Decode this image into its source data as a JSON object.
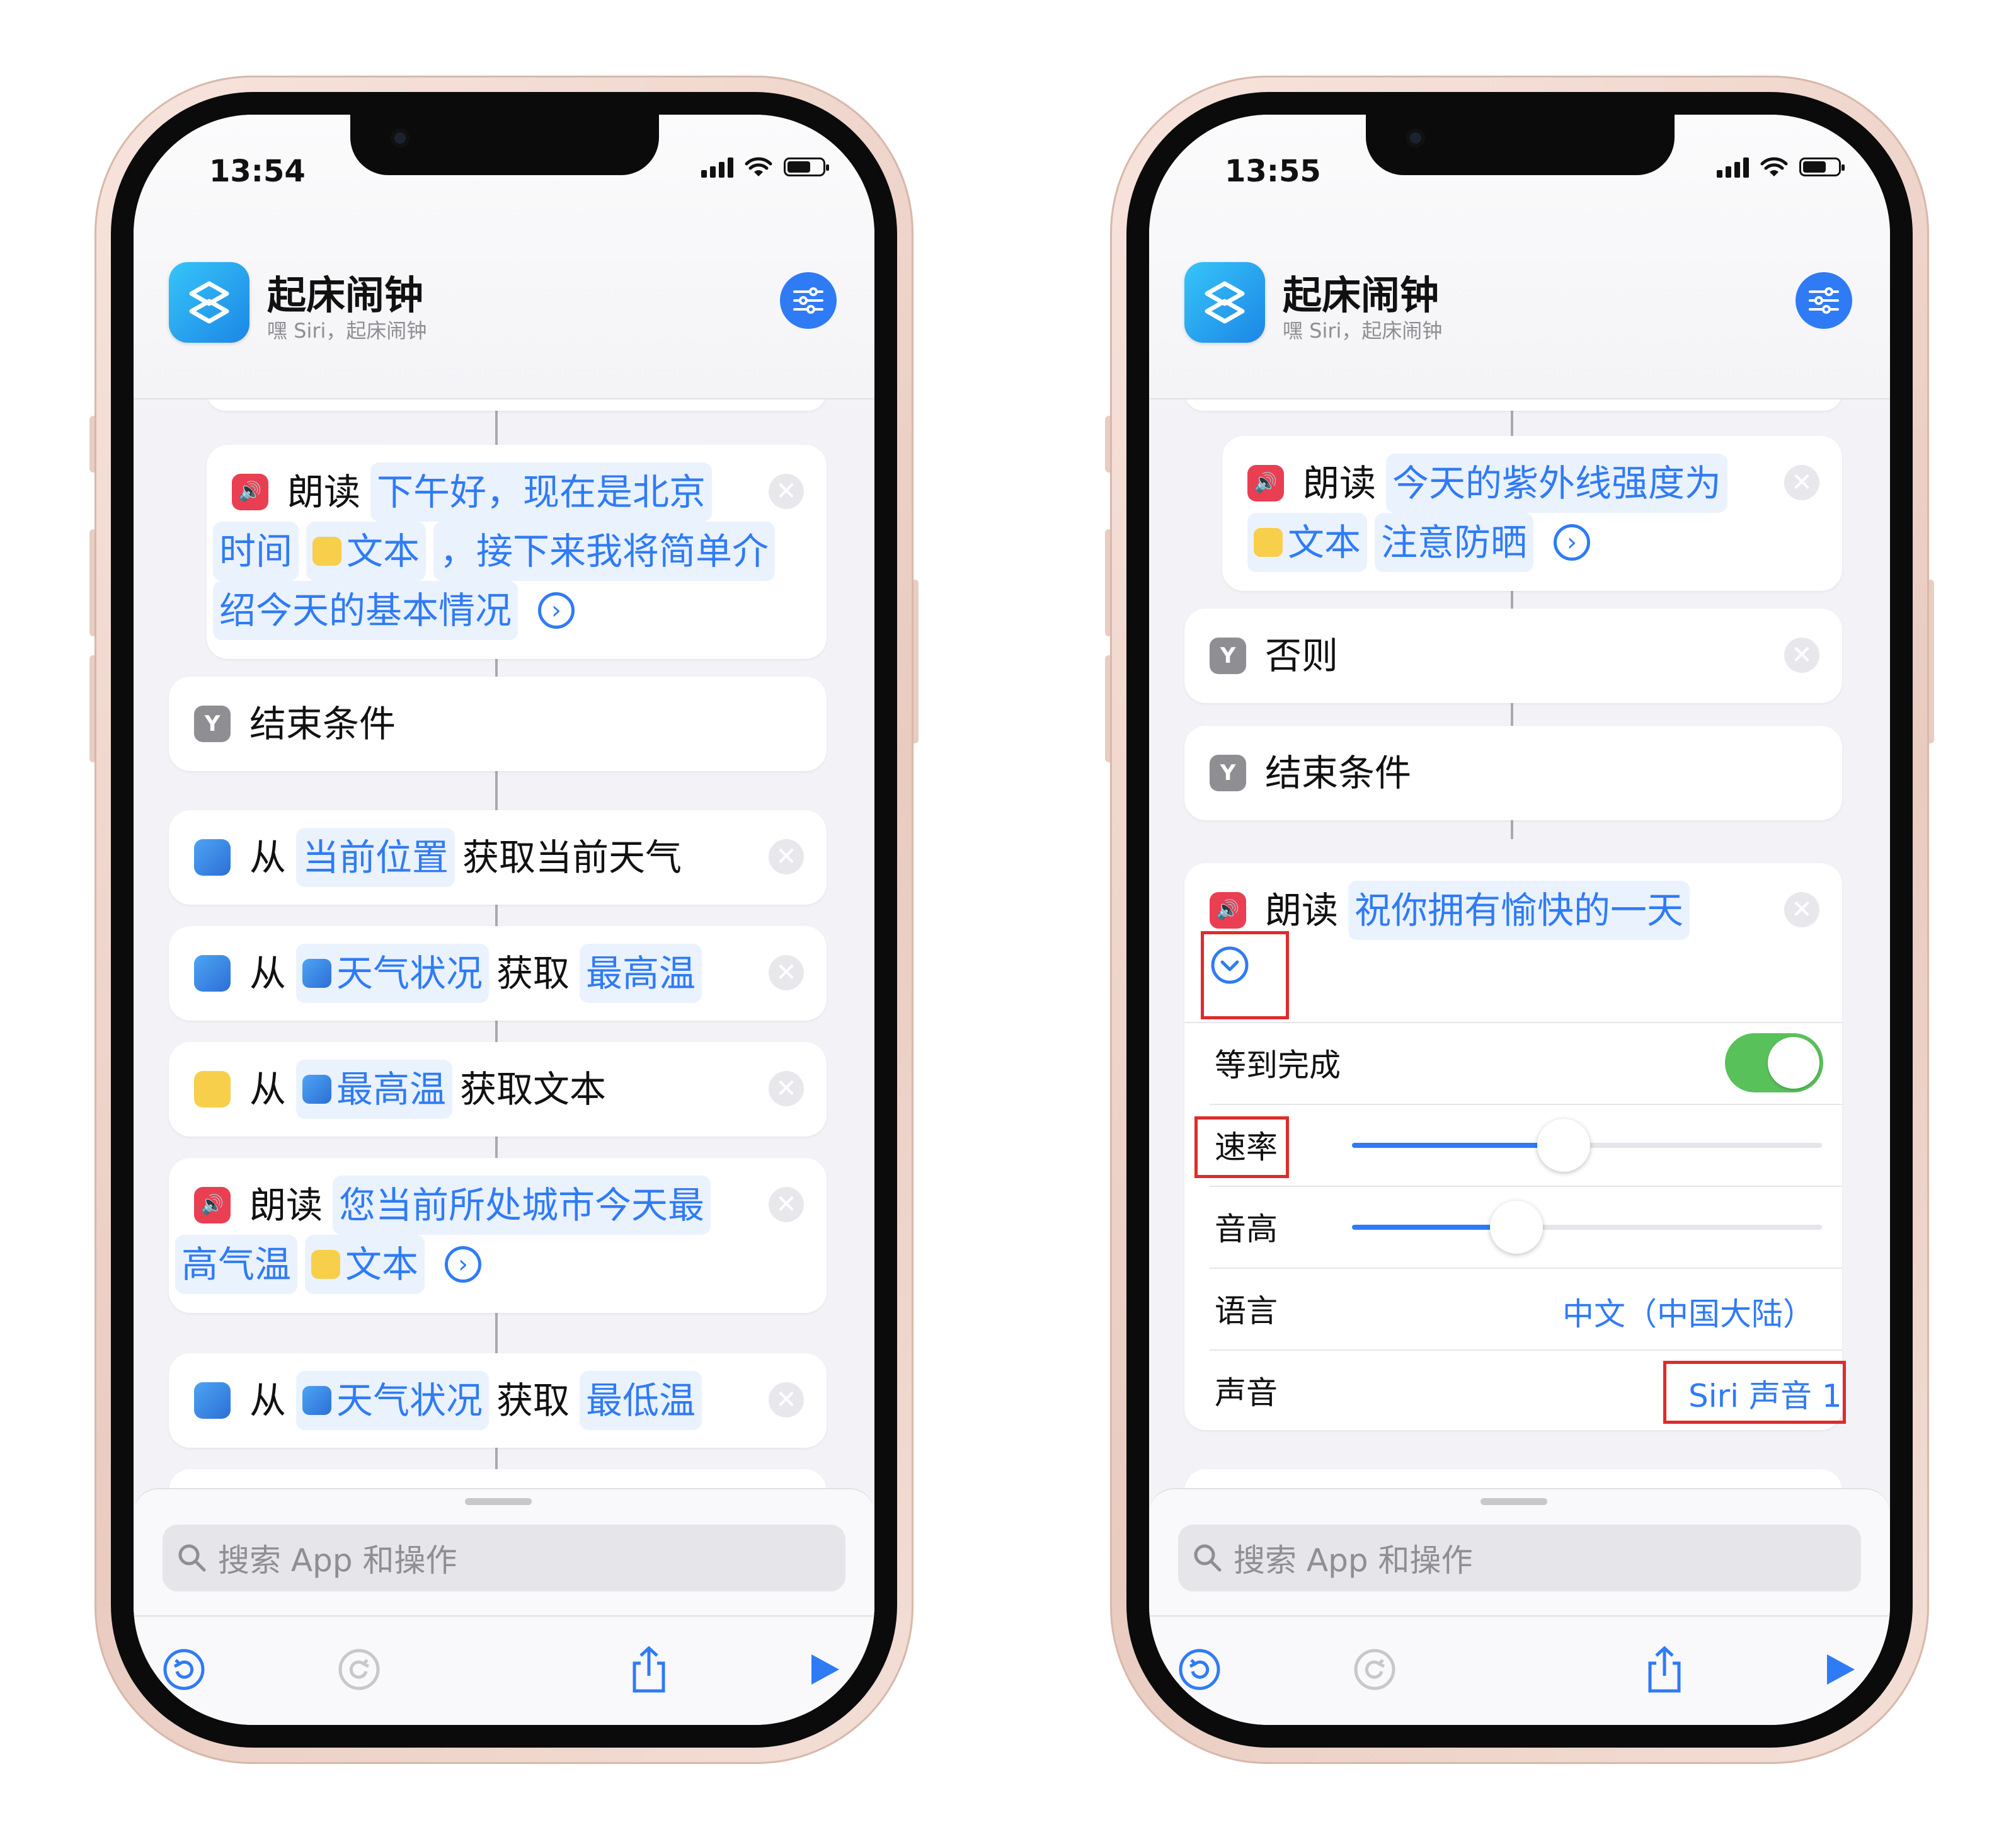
{
  "left": {
    "status_time": "13:54",
    "shortcut": {
      "title": "起床闹钟",
      "subtitle": "嘿 Siri，起床闹钟"
    },
    "actions": {
      "speak1": {
        "verb": "朗读",
        "t1": "下午好，现在是北京",
        "t2": "时间",
        "t3": "文本",
        "t4": "，接下来我将简单介",
        "t5": "绍今天的基本情况"
      },
      "end_if": {
        "label": "结束条件"
      },
      "get_weather": {
        "verb": "从",
        "location": "当前位置",
        "rest": "获取当前天气"
      },
      "get_high": {
        "verb": "从",
        "var": "天气状况",
        "mid": "获取",
        "field": "最高温"
      },
      "get_text": {
        "verb": "从",
        "var": "最高温",
        "rest": "获取文本"
      },
      "speak2": {
        "verb": "朗读",
        "t1": "您当前所处城市今天最",
        "t2": "高气温",
        "t3": "文本"
      },
      "get_low": {
        "verb": "从",
        "var": "天气状况",
        "mid": "获取",
        "field": "最低温"
      }
    }
  },
  "right": {
    "status_time": "13:55",
    "shortcut": {
      "title": "起床闹钟",
      "subtitle": "嘿 Siri，起床闹钟"
    },
    "actions": {
      "speak_uv": {
        "verb": "朗读",
        "t1": "今天的紫外线强度为",
        "t2": "文本",
        "t3": "注意防晒"
      },
      "otherwise": {
        "label": "否则"
      },
      "end_if": {
        "label": "结束条件"
      },
      "speak_final": {
        "verb": "朗读",
        "text": "祝你拥有愉快的一天"
      }
    },
    "options": {
      "wait_label": "等到完成",
      "wait_on": true,
      "rate_label": "速率",
      "rate_value": 0.45,
      "pitch_label": "音高",
      "pitch_value": 0.35,
      "language_label": "语言",
      "language_value": "中文（中国大陆）",
      "voice_label": "声音",
      "voice_value": "Siri 声音 1"
    }
  },
  "search": {
    "placeholder": "搜索 App 和操作"
  },
  "colors": {
    "accent": "#2f7bf6",
    "highlight_box": "#e02a2a",
    "toggle_on": "#59c15a",
    "speak_icon": "#ea3f52"
  },
  "icons": [
    "shortcuts-icon",
    "settings-sliders-icon",
    "close-icon",
    "speaker-icon",
    "condition-icon",
    "weather-icon",
    "text-icon",
    "chevron-right-circle-icon",
    "chevron-down-circle-icon",
    "search-icon",
    "undo-icon",
    "redo-icon",
    "share-icon",
    "play-icon"
  ]
}
